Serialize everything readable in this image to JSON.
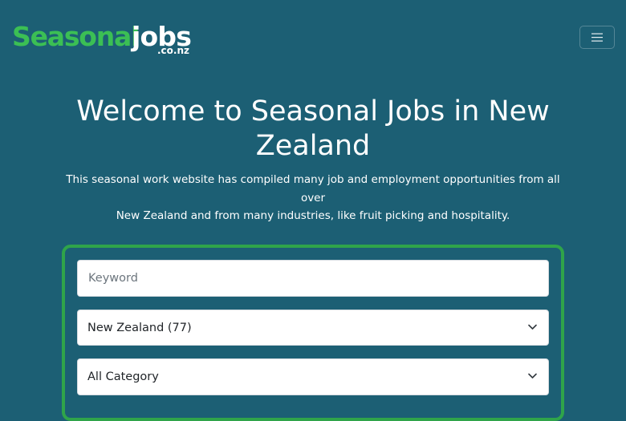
{
  "brand": {
    "logo_word1": "Seasonal",
    "logo_word2": "jobs",
    "logo_domain": ".co.nz",
    "word1_color": "#3bbf54"
  },
  "navbar": {
    "toggler_icon": "hamburger-menu-icon"
  },
  "hero": {
    "title": "Welcome to Seasonal Jobs in New Zealand",
    "description_line1": "This seasonal work website has compiled many job and employment opportunities from all over",
    "description_line2": "New Zealand and from many industries, like fruit picking and hospitality."
  },
  "search": {
    "keyword_placeholder": "Keyword",
    "region_selected": "New Zealand (77)",
    "category_selected": "All Category",
    "card_border_color": "#2fa44a"
  },
  "colors": {
    "background": "#1c5f74",
    "text": "#ffffff"
  }
}
